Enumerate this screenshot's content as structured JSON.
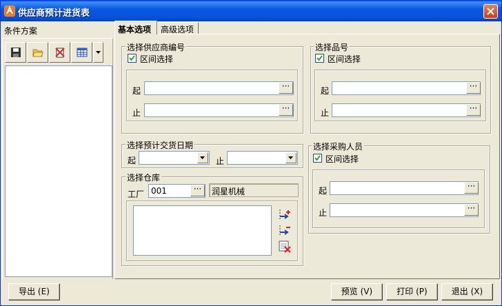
{
  "window": {
    "title": "供应商预计进货表"
  },
  "left": {
    "title": "条件方案",
    "toolbar": [
      "save-icon",
      "open-folder-icon",
      "delete-icon",
      "grid-icon"
    ]
  },
  "tabs": [
    {
      "label": "基本选项",
      "active": true
    },
    {
      "label": "高级选项",
      "active": false
    }
  ],
  "supplier": {
    "title": "选择供应商编号",
    "range_label": "区间选择",
    "range_checked": true,
    "from_label": "起",
    "to_label": "止",
    "from_value": "",
    "to_value": ""
  },
  "product": {
    "title": "选择品号",
    "range_label": "区间选择",
    "range_checked": true,
    "from_label": "起",
    "to_label": "止",
    "from_value": "",
    "to_value": ""
  },
  "delivery": {
    "title": "选择预计交货日期",
    "from_label": "起",
    "to_label": "止",
    "from_value": "",
    "to_value": ""
  },
  "buyer": {
    "title": "选择采购人员",
    "range_label": "区间选择",
    "range_checked": true,
    "from_label": "起",
    "to_label": "止",
    "from_value": "",
    "to_value": ""
  },
  "warehouse": {
    "title": "选择仓库",
    "factory_label": "工厂",
    "factory_code": "001",
    "factory_name": "润星机械"
  },
  "ellipsis": "···",
  "buttons": {
    "export": "导出 (E)",
    "preview": "预览 (V)",
    "print": "打印 (P)",
    "exit": "退出 (X)"
  },
  "colors": {
    "titlebar": "#0a58e0",
    "window_bg": "#ece9d8",
    "accent_icon": "#f07818"
  }
}
